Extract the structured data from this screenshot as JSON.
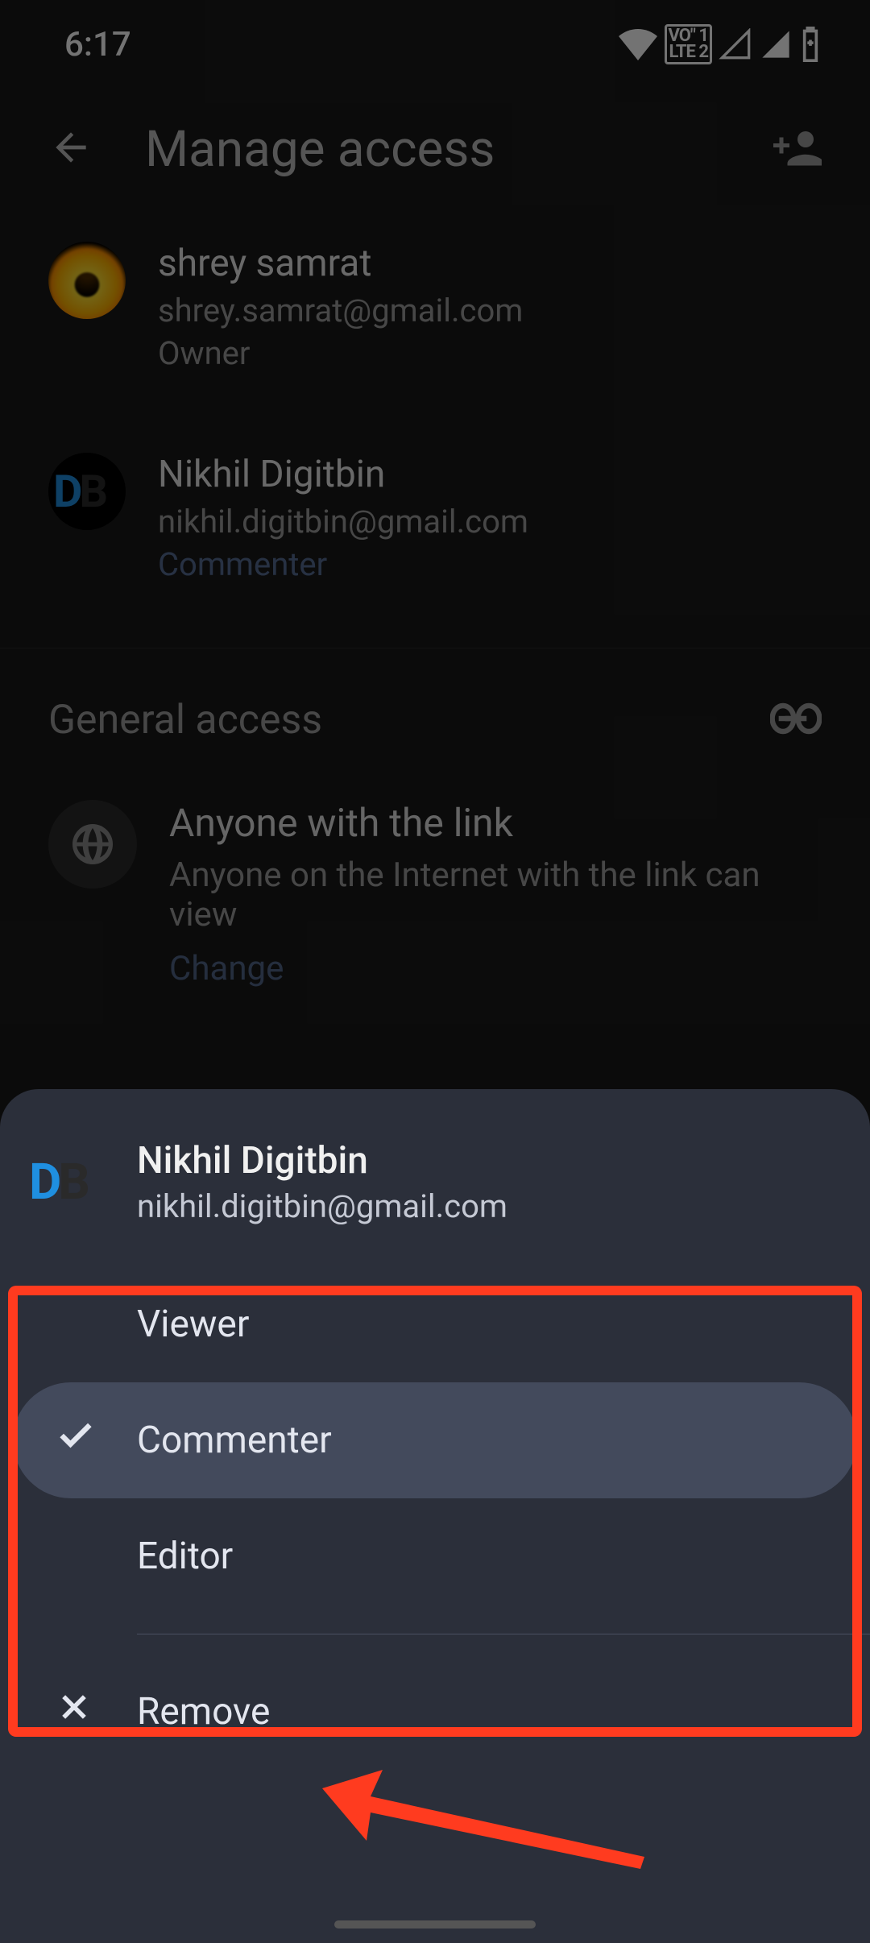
{
  "status": {
    "time": "6:17",
    "lte_top": "VO\" 1",
    "lte_bottom": "LTE 2"
  },
  "header": {
    "title": "Manage access"
  },
  "people": [
    {
      "name": "shrey samrat",
      "email": "shrey.samrat@gmail.com",
      "role": "Owner"
    },
    {
      "name": "Nikhil Digitbin",
      "email": "nikhil.digitbin@gmail.com",
      "role": "Commenter"
    }
  ],
  "general": {
    "heading": "General access",
    "link_title": "Anyone with the link",
    "link_desc": "Anyone on the Internet with the link can view",
    "change": "Change"
  },
  "sheet": {
    "name": "Nikhil Digitbin",
    "email": "nikhil.digitbin@gmail.com",
    "options": [
      "Viewer",
      "Commenter",
      "Editor"
    ],
    "selected_index": 1,
    "remove": "Remove"
  }
}
